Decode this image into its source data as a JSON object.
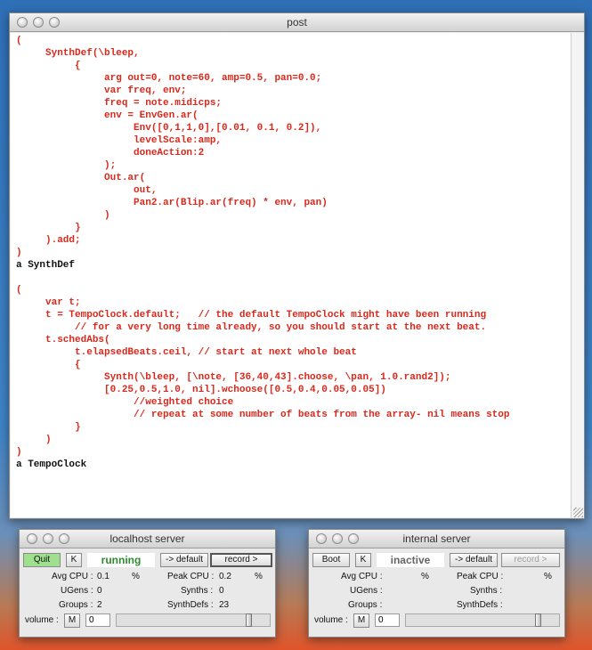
{
  "post_window": {
    "title": "post",
    "lines": [
      {
        "text": "(",
        "kind": "code"
      },
      {
        "text": "     SynthDef(\\bleep,",
        "kind": "code"
      },
      {
        "text": "          {",
        "kind": "code"
      },
      {
        "text": "               arg out=0, note=60, amp=0.5, pan=0.0;",
        "kind": "code"
      },
      {
        "text": "               var freq, env;",
        "kind": "code"
      },
      {
        "text": "               freq = note.midicps;",
        "kind": "code"
      },
      {
        "text": "               env = EnvGen.ar(",
        "kind": "code"
      },
      {
        "text": "                    Env([0,1,1,0],[0.01, 0.1, 0.2]),",
        "kind": "code"
      },
      {
        "text": "                    levelScale:amp,",
        "kind": "code"
      },
      {
        "text": "                    doneAction:2",
        "kind": "code"
      },
      {
        "text": "               );",
        "kind": "code"
      },
      {
        "text": "               Out.ar(",
        "kind": "code"
      },
      {
        "text": "                    out,",
        "kind": "code"
      },
      {
        "text": "                    Pan2.ar(Blip.ar(freq) * env, pan)",
        "kind": "code"
      },
      {
        "text": "               )",
        "kind": "code"
      },
      {
        "text": "          }",
        "kind": "code"
      },
      {
        "text": "     ).add;",
        "kind": "code"
      },
      {
        "text": ")",
        "kind": "code"
      },
      {
        "text": "a SynthDef",
        "kind": "out"
      },
      {
        "text": "",
        "kind": "code"
      },
      {
        "text": "(",
        "kind": "code"
      },
      {
        "text": "     var t;",
        "kind": "code"
      },
      {
        "text": "     t = TempoClock.default;   // the default TempoClock might have been running",
        "kind": "code"
      },
      {
        "text": "          // for a very long time already, so you should start at the next beat.",
        "kind": "code"
      },
      {
        "text": "     t.schedAbs(",
        "kind": "code"
      },
      {
        "text": "          t.elapsedBeats.ceil, // start at next whole beat",
        "kind": "code"
      },
      {
        "text": "          {",
        "kind": "code"
      },
      {
        "text": "               Synth(\\bleep, [\\note, [36,40,43].choose, \\pan, 1.0.rand2]);",
        "kind": "code"
      },
      {
        "text": "               [0.25,0.5,1.0, nil].wchoose([0.5,0.4,0.05,0.05])",
        "kind": "code"
      },
      {
        "text": "                    //weighted choice",
        "kind": "code"
      },
      {
        "text": "                    // repeat at some number of beats from the array- nil means stop",
        "kind": "code"
      },
      {
        "text": "          }",
        "kind": "code"
      },
      {
        "text": "     )",
        "kind": "code"
      },
      {
        "text": ")",
        "kind": "code"
      },
      {
        "text": "a TempoClock",
        "kind": "out"
      }
    ]
  },
  "localhost_server": {
    "title": "localhost server",
    "quit_label": "Quit",
    "k_label": "K",
    "status": "running",
    "default_label": "-> default",
    "record_label": "record >",
    "avg_cpu_label": "Avg CPU :",
    "avg_cpu_value": "0.1",
    "avg_cpu_unit": "%",
    "peak_cpu_label": "Peak CPU :",
    "peak_cpu_value": "0.2",
    "peak_cpu_unit": "%",
    "ugens_label": "UGens :",
    "ugens_value": "0",
    "synths_label": "Synths :",
    "synths_value": "0",
    "groups_label": "Groups :",
    "groups_value": "2",
    "synthdefs_label": "SynthDefs :",
    "synthdefs_value": "23",
    "volume_label": "volume :",
    "m_label": "M",
    "volume_value": "0",
    "volume_level": 0.88
  },
  "internal_server": {
    "title": "internal server",
    "boot_label": "Boot",
    "k_label": "K",
    "status": "inactive",
    "default_label": "-> default",
    "record_label": "record >",
    "avg_cpu_label": "Avg CPU :",
    "avg_cpu_unit": "%",
    "peak_cpu_label": "Peak CPU :",
    "peak_cpu_unit": "%",
    "ugens_label": "UGens :",
    "synths_label": "Synths :",
    "groups_label": "Groups :",
    "synthdefs_label": "SynthDefs :",
    "volume_label": "volume :",
    "m_label": "M",
    "volume_value": "0",
    "volume_level": 0.88
  },
  "colors": {
    "code": "#d8291c",
    "output": "#111111",
    "running": "#2e8b2e",
    "quit_button": "#9fe08f"
  }
}
